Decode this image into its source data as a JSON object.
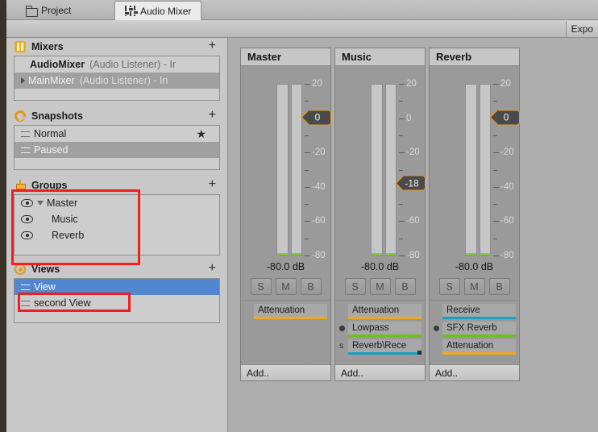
{
  "window": {
    "tabs": [
      {
        "label": "Project",
        "icon": "folder-icon",
        "active": false
      },
      {
        "label": "Audio Mixer",
        "icon": "mixer-sliders-icon",
        "active": true
      }
    ],
    "toolbar": {
      "exposed_params_label": "Expo"
    }
  },
  "sidebar": {
    "sections": [
      {
        "id": "mixers",
        "title": "Mixers",
        "icon": "mixers-icon",
        "add_label": "+",
        "items": [
          {
            "name": "AudioMixer",
            "detail": "(Audio Listener) - Ir",
            "selected": false,
            "expandable": false
          },
          {
            "name": "MainMixer",
            "detail": "(Audio Listener) - In",
            "selected": true,
            "expandable": true
          }
        ]
      },
      {
        "id": "snapshots",
        "title": "Snapshots",
        "icon": "snapshots-icon",
        "add_label": "+",
        "items": [
          {
            "name": "Normal",
            "selected": false,
            "starred": true
          },
          {
            "name": "Paused",
            "selected": true,
            "starred": false
          }
        ]
      },
      {
        "id": "groups",
        "title": "Groups",
        "icon": "groups-icon",
        "add_label": "+",
        "highlighted": true,
        "items": [
          {
            "name": "Master",
            "indent": 0,
            "expanded": true
          },
          {
            "name": "Music",
            "indent": 1,
            "expanded": false
          },
          {
            "name": "Reverb",
            "indent": 1,
            "expanded": false
          }
        ]
      },
      {
        "id": "views",
        "title": "Views",
        "icon": "views-icon",
        "add_label": "+",
        "items": [
          {
            "name": "View",
            "selected": true,
            "highlighted": true
          },
          {
            "name": "second View",
            "selected": false,
            "highlighted": false
          }
        ]
      }
    ]
  },
  "mixer": {
    "scale_labels": [
      "20",
      "0",
      "-20",
      "-40",
      "-60",
      "-80"
    ],
    "scale_max": 20,
    "scale_min": -80,
    "add_effect_label": "Add..",
    "solo_label": "S",
    "mute_label": "M",
    "bypass_label": "B",
    "strips": [
      {
        "name": "Master",
        "fader_value": "0",
        "fader_db": 0,
        "level_db": "-80.0 dB",
        "effects": [
          {
            "name": "Attenuation",
            "color": "#f0a81e",
            "marker": "",
            "handle": false
          }
        ]
      },
      {
        "name": "Music",
        "fader_value": "-18",
        "fader_db": -18,
        "level_db": "-80.0 dB",
        "effects": [
          {
            "name": "Attenuation",
            "color": "#f0a81e",
            "marker": "",
            "handle": false
          },
          {
            "name": "Lowpass",
            "color": "#6fbf1b",
            "marker": "dot",
            "handle": false
          },
          {
            "name": "Reverb\\Rece",
            "color": "#1a9fc4",
            "marker": "s",
            "handle": true
          }
        ]
      },
      {
        "name": "Reverb",
        "fader_value": "0",
        "fader_db": 0,
        "level_db": "-80.0 dB",
        "effects": [
          {
            "name": "Receive",
            "color": "#1a9fc4",
            "marker": "",
            "handle": false
          },
          {
            "name": "SFX Reverb",
            "color": "#6fbf1b",
            "marker": "dot",
            "handle": false
          },
          {
            "name": "Attenuation",
            "color": "#f0a81e",
            "marker": "",
            "handle": false
          }
        ]
      }
    ]
  },
  "colors": {
    "accent_orange": "#e8961c",
    "selection_blue": "#5186d0",
    "highlight_red": "#f41d1d",
    "meter_green": "#86d02c"
  }
}
